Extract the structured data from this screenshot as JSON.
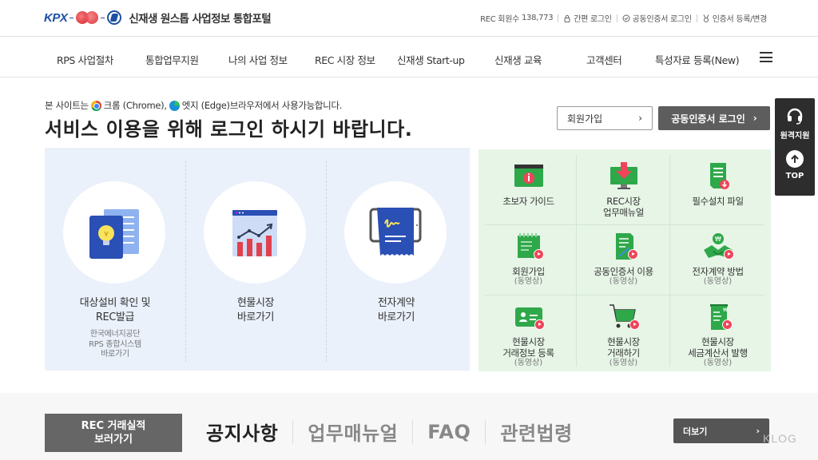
{
  "header": {
    "logo_text": "KPX",
    "portal_title": "신재생 원스톱 사업정보 통합포털",
    "util": {
      "member_count_label": "REC 회원수",
      "member_count": "138,773",
      "simple_login": "간편 로그인",
      "cert_login": "공동인증서 로그인",
      "cert_register": "인증서 등록/변경"
    }
  },
  "nav": {
    "items": [
      {
        "label": "RPS 사업절차"
      },
      {
        "label": "통합업무지원"
      },
      {
        "label": "나의 사업 정보"
      },
      {
        "label": "REC 시장 정보"
      },
      {
        "label": "신재생 Start-up"
      },
      {
        "label": "신재생 교육"
      },
      {
        "label": "고객센터"
      },
      {
        "label": "특성자료 등록(New)"
      }
    ]
  },
  "intro": {
    "note_prefix": "본 사이트는",
    "chrome": "크롬 (Chrome),",
    "edge": "엣지 (Edge)브라우저에서 사용가능합니다.",
    "headline": "서비스 이용을 위해 로그인 하시기 바랍니다."
  },
  "actions": {
    "join": "회원가입",
    "cert_login": "공동인증서 로그인",
    "chevron": "›"
  },
  "quickbar": {
    "remote": "원격지원",
    "top": "TOP"
  },
  "blue_cards": [
    {
      "title_line1": "대상설비 확인 및",
      "title_line2": "REC발급",
      "sub1": "한국에너지공단",
      "sub2": "RPS 종합시스템",
      "sub3": "바로가기"
    },
    {
      "title_line1": "현물시장",
      "title_line2": "바로가기"
    },
    {
      "title_line1": "전자계약",
      "title_line2": "바로가기"
    }
  ],
  "green_cells": [
    {
      "line1": "초보자 가이드",
      "line2": "",
      "sub": ""
    },
    {
      "line1": "REC시장",
      "line2": "업무매뉴얼",
      "sub": ""
    },
    {
      "line1": "필수설치 파일",
      "line2": "",
      "sub": ""
    },
    {
      "line1": "회원가입",
      "line2": "",
      "sub": "(동영상)"
    },
    {
      "line1": "공동인증서 이용",
      "line2": "",
      "sub": "(동영상)"
    },
    {
      "line1": "전자계약 방법",
      "line2": "",
      "sub": "(동영상)"
    },
    {
      "line1": "현물시장",
      "line2": "거래정보 등록",
      "sub": "(동영상)"
    },
    {
      "line1": "현물시장",
      "line2": "거래하기",
      "sub": "(동영상)"
    },
    {
      "line1": "현물시장",
      "line2": "세금계산서 발행",
      "sub": "(동영상)"
    }
  ],
  "bottom": {
    "rec_button_line1": "REC 거래실적",
    "rec_button_line2": "보러가기",
    "tabs": [
      {
        "label": "공지사항",
        "active": true
      },
      {
        "label": "업무매뉴얼",
        "active": false
      },
      {
        "label": "FAQ",
        "active": false
      },
      {
        "label": "관련법령",
        "active": false
      }
    ],
    "more": "더보기",
    "more_chevron": "›",
    "watermark": "KLOG"
  }
}
